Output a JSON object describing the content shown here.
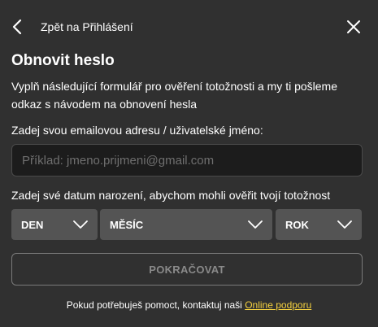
{
  "header": {
    "back_label": "Zpět na Přihlášení",
    "back_icon": "chevron-left-icon",
    "close_icon": "close-icon"
  },
  "form": {
    "title": "Obnovit heslo",
    "description": "Vyplň následující formulář pro ověření totožnosti a my ti pošleme odkaz s návodem na obnovení hesla",
    "email_label": "Zadej svou emailovou adresu / uživatelské jméno:",
    "email_value": "",
    "email_placeholder": "Příklad: jmeno.prijmeni@gmail.com",
    "dob_label": "Zadej své datum narození, abychom mohli ověřit tvojí totožnost",
    "day_select": {
      "selected": "DEN"
    },
    "month_select": {
      "selected": "MĚSÍC"
    },
    "year_select": {
      "selected": "ROK"
    },
    "submit_label": "POKRAČOVAT"
  },
  "footer": {
    "help_text": "Pokud potřebuješ pomoct, kontaktuj naši",
    "help_link": "Online podporu"
  },
  "colors": {
    "background": "#303030",
    "input_bg": "#1c1c1c",
    "select_bg": "#545454",
    "link": "#f4d03f",
    "button_text": "#8a8a8a"
  }
}
